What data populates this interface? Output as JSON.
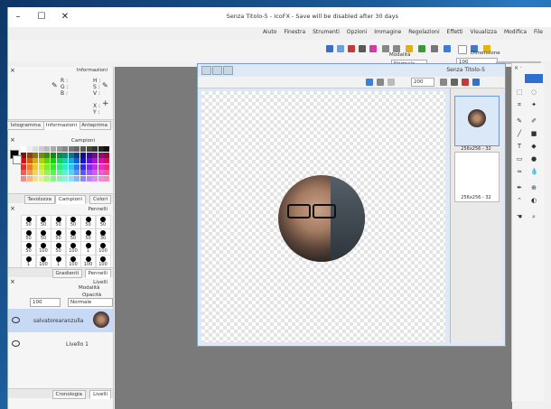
{
  "window": {
    "title": "Senza Titolo-5 - IcoFX - Save will be disabled after 30 days",
    "controls": {
      "minimize": "–",
      "maximize": "☐",
      "close": "✕"
    }
  },
  "menu": [
    "File",
    "Modifica",
    "Visualizza",
    "Effetti",
    "Regolazioni",
    "Immagine",
    "Opzioni",
    "Strumenti",
    "Finestra",
    "Aiuto"
  ],
  "toolbar": {
    "modalita_label": "Modalità",
    "modalita_value": "Normale",
    "dimensione_label": "Dimensione",
    "dimensione_value": "100"
  },
  "info_panel": {
    "title": "Informazioni",
    "rgb": [
      "R :",
      "G :",
      "B :"
    ],
    "hsv": [
      "H :",
      "S :",
      "V :"
    ],
    "xy": [
      "X :",
      "Y :"
    ],
    "tabs": [
      "Anteprima",
      "Informazioni",
      "Istogramma"
    ]
  },
  "color_panel": {
    "title": "Campioni",
    "tabs": [
      "Colori",
      "Campioni",
      "Tavolozza"
    ]
  },
  "brush_panel": {
    "title": "Pennelli",
    "row1": [
      "50",
      "50",
      "50",
      "50",
      "50",
      "50"
    ],
    "row2": [
      "30",
      "50",
      "50",
      "50",
      "50",
      "50"
    ],
    "row3": [
      "100",
      "1",
      "100",
      "50",
      "100",
      "50"
    ],
    "row4": [
      "100",
      "100",
      "100",
      "1",
      "100",
      "1"
    ],
    "tabs": [
      "Pennelli",
      "Gradienti"
    ]
  },
  "layers_panel": {
    "title": "Livelli",
    "modalita_label": "Modalità",
    "modalita_value": "Normale",
    "opacita_label": "Opacità",
    "opacita_value": "100",
    "layers": [
      "salvatorearanzulla",
      "Livello 1"
    ],
    "tabs": [
      "Livelli",
      "Cronologia"
    ]
  },
  "document": {
    "title": "Senza Titolo-5",
    "zoom": "200"
  },
  "thumbnails": [
    "256x256 - 32",
    "256x256 - 32"
  ],
  "colors": {
    "accent": "#2f6fd1",
    "selection": "#c7d9f5"
  }
}
